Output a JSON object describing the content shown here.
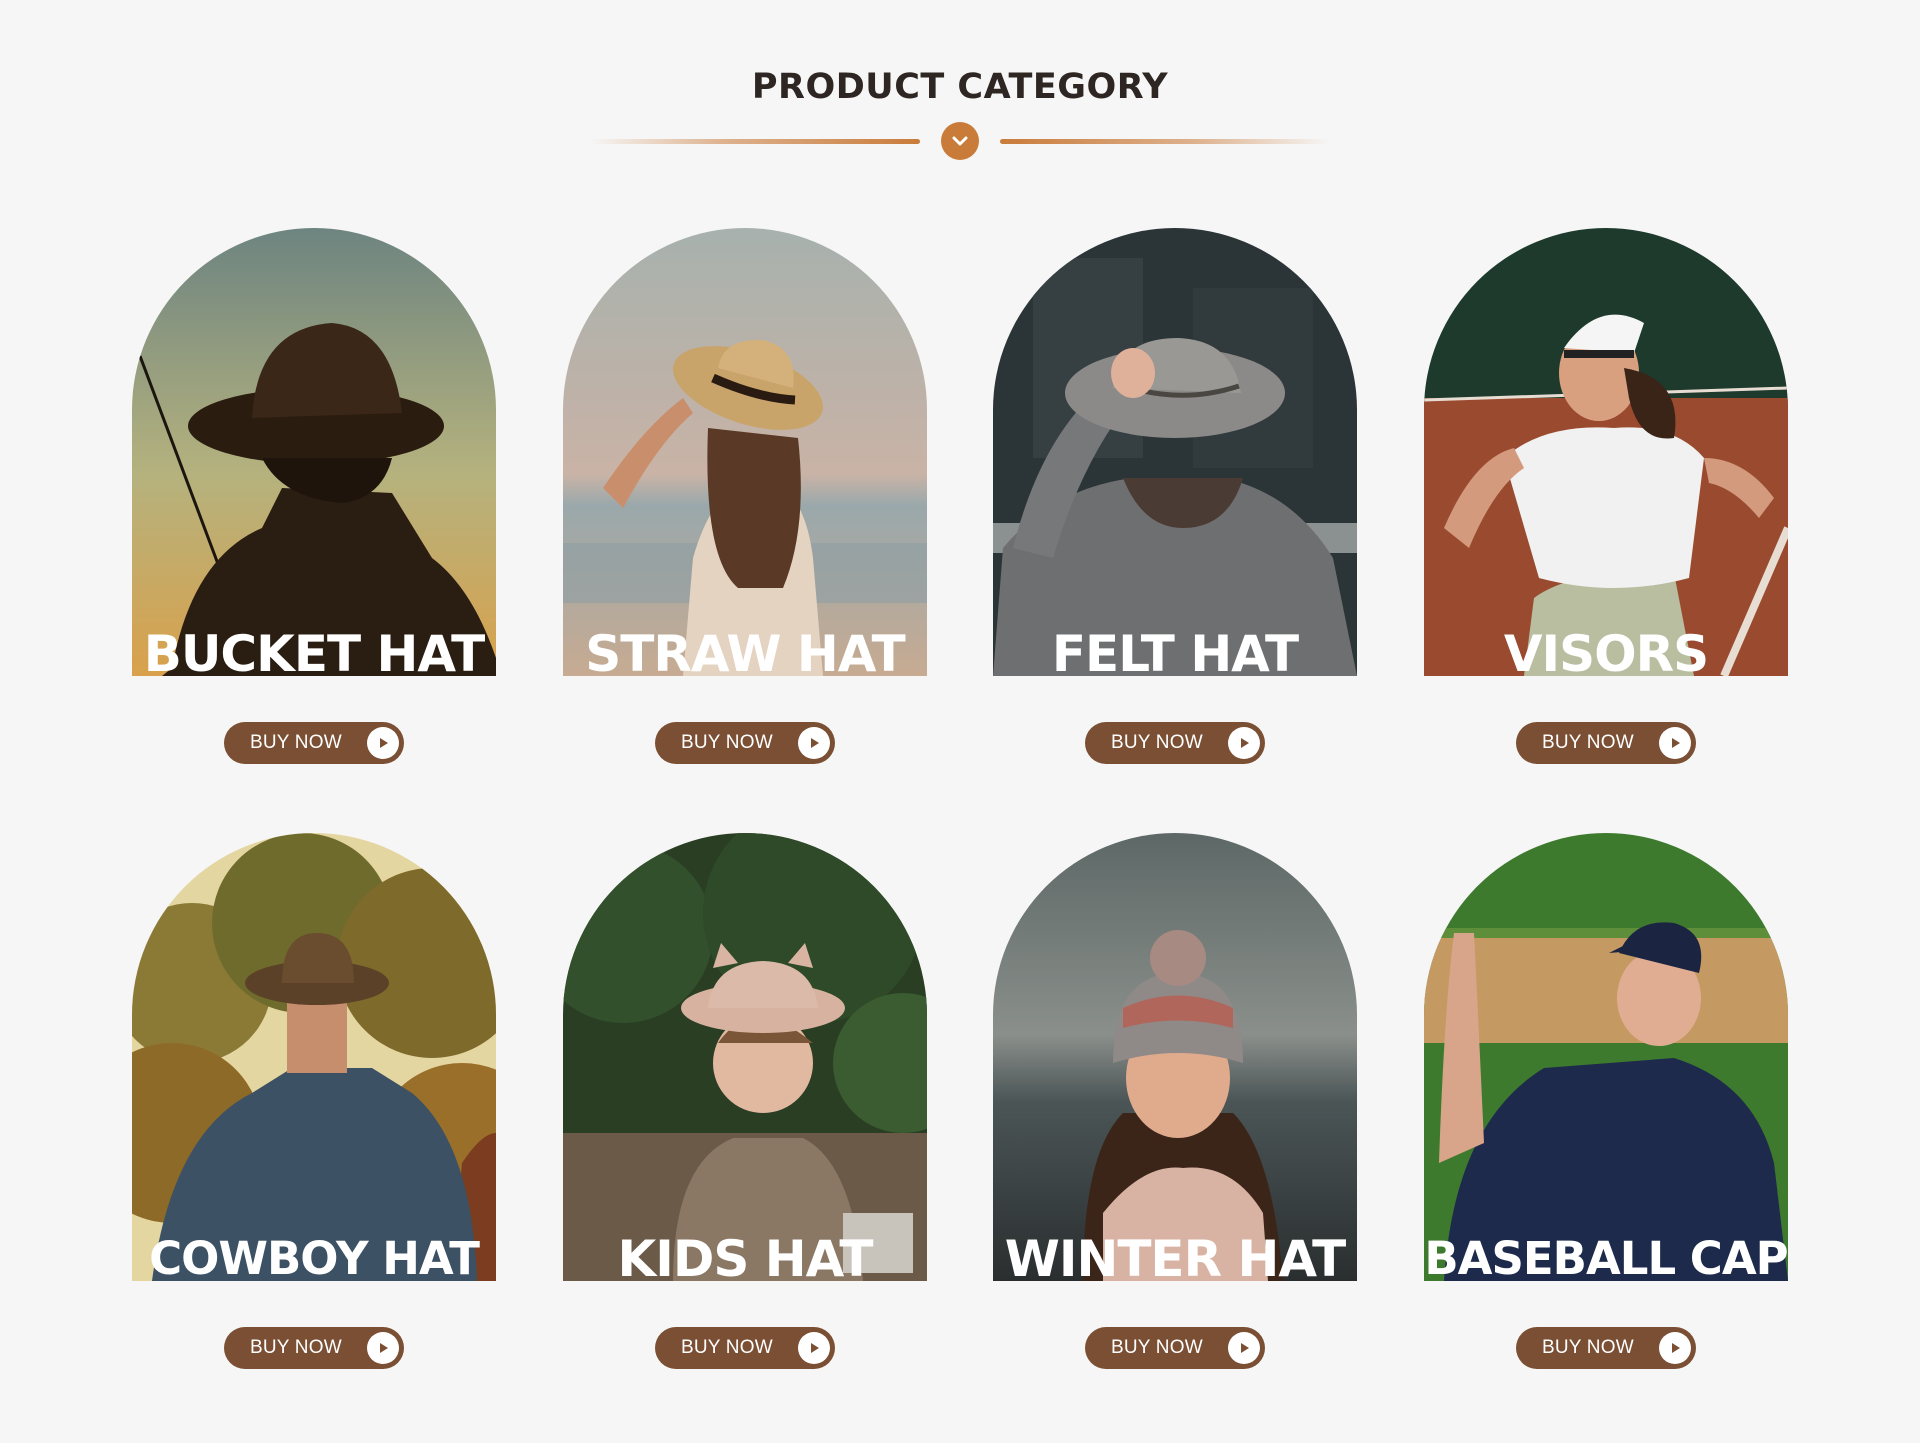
{
  "header": {
    "title": "PRODUCT CATEGORY",
    "divider_icon": "chevron-down-icon",
    "accent_color": "#c97b3a"
  },
  "categories": [
    {
      "label": "BUCKET HAT",
      "button": "BUY NOW"
    },
    {
      "label": "STRAW HAT",
      "button": "BUY NOW"
    },
    {
      "label": "FELT HAT",
      "button": "BUY NOW"
    },
    {
      "label": "VISORS",
      "button": "BUY NOW"
    },
    {
      "label": "COWBOY HAT",
      "button": "BUY NOW"
    },
    {
      "label": "KIDS HAT",
      "button": "BUY NOW"
    },
    {
      "label": "WINTER HAT",
      "button": "BUY NOW"
    },
    {
      "label": "BASEBALL CAP",
      "button": "BUY NOW"
    }
  ],
  "button_color": "#7a4f34",
  "button_icon": "play-icon"
}
